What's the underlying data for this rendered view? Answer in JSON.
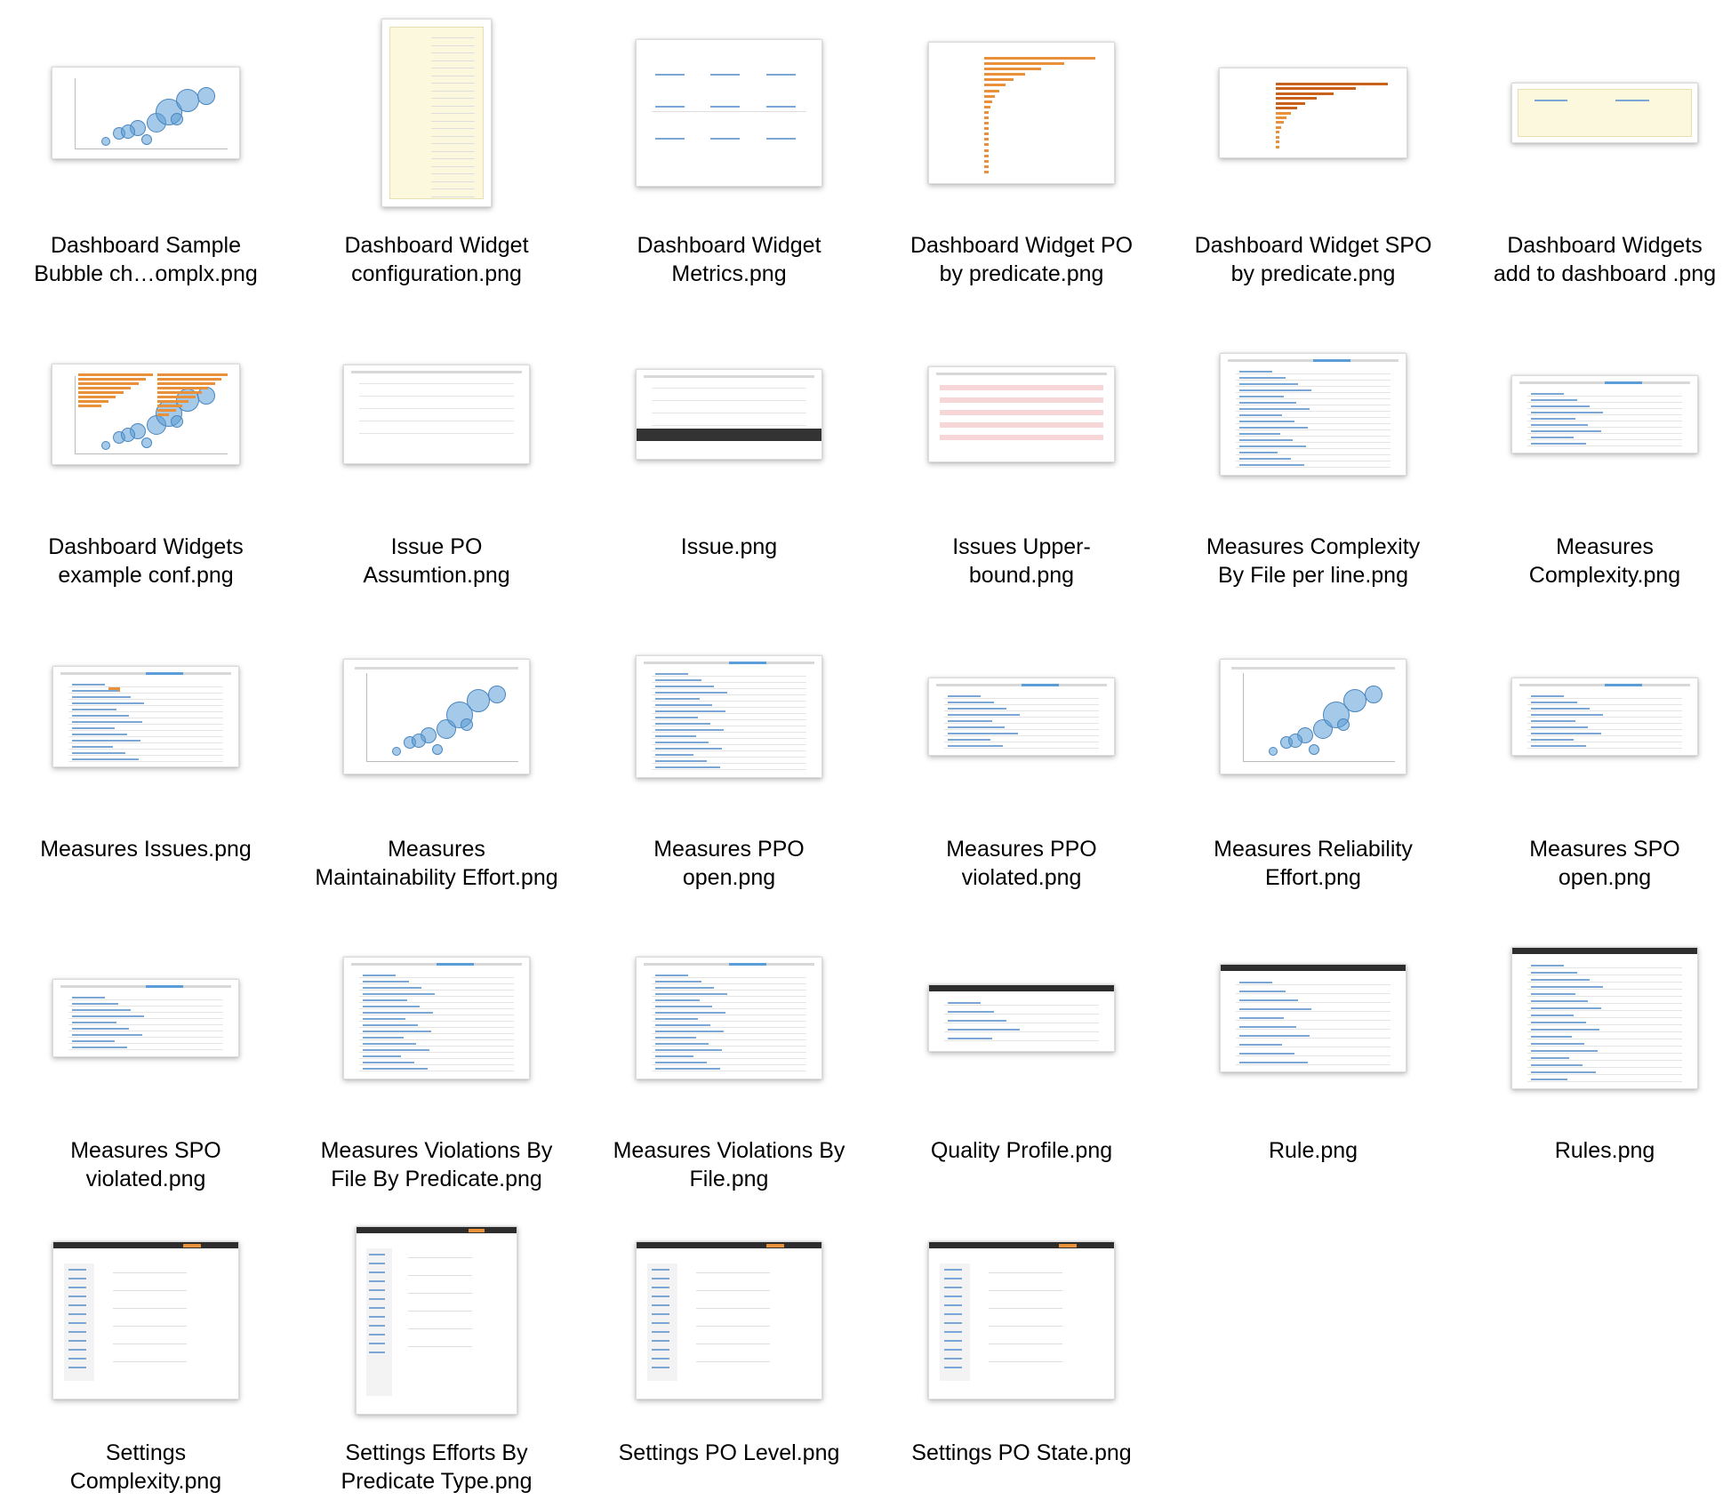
{
  "window": {
    "view": "icon-grid"
  },
  "files": [
    {
      "line1": "Dashboard Sample",
      "line2": "Bubble ch…omplx.png",
      "kind": "bubble"
    },
    {
      "line1": "Dashboard Widget",
      "line2": "configuration.png",
      "kind": "config"
    },
    {
      "line1": "Dashboard Widget",
      "line2": "Metrics.png",
      "kind": "metrics"
    },
    {
      "line1": "Dashboard Widget PO",
      "line2": "by predicate.png",
      "kind": "hbar"
    },
    {
      "line1": "Dashboard Widget SPO",
      "line2": "by predicate.png",
      "kind": "hbar-dark"
    },
    {
      "line1": "Dashboard Widgets",
      "line2": "add to dashboard .png",
      "kind": "addwidget"
    },
    {
      "line1": "Dashboard Widgets",
      "line2": "example conf.png",
      "kind": "combo"
    },
    {
      "line1": "Issue PO",
      "line2": "Assumtion.png",
      "kind": "issue"
    },
    {
      "line1": "Issue.png",
      "line2": "",
      "kind": "issue-dark"
    },
    {
      "line1": "Issues Upper-",
      "line2": "bound.png",
      "kind": "issue-red"
    },
    {
      "line1": "Measures Complexity",
      "line2": "By File per line.png",
      "kind": "list-tall"
    },
    {
      "line1": "Measures",
      "line2": "Complexity.png",
      "kind": "list"
    },
    {
      "line1": "Measures Issues.png",
      "line2": "",
      "kind": "list-badge"
    },
    {
      "line1": "Measures",
      "line2": "Maintainability Effort.png",
      "kind": "bubble-page"
    },
    {
      "line1": "Measures PPO",
      "line2": "open.png",
      "kind": "list-tall"
    },
    {
      "line1": "Measures PPO",
      "line2": "violated.png",
      "kind": "list"
    },
    {
      "line1": "Measures Reliability",
      "line2": "Effort.png",
      "kind": "bubble-page"
    },
    {
      "line1": "Measures SPO",
      "line2": "open.png",
      "kind": "list"
    },
    {
      "line1": "Measures SPO",
      "line2": "violated.png",
      "kind": "list"
    },
    {
      "line1": "Measures Violations By",
      "line2": "File By Predicate.png",
      "kind": "list-tall"
    },
    {
      "line1": "Measures Violations By",
      "line2": "File.png",
      "kind": "list-tall"
    },
    {
      "line1": "Quality Profile.png",
      "line2": "",
      "kind": "profile"
    },
    {
      "line1": "Rule.png",
      "line2": "",
      "kind": "rule"
    },
    {
      "line1": "Rules.png",
      "line2": "",
      "kind": "rules"
    },
    {
      "line1": "Settings",
      "line2": "Complexity.png",
      "kind": "settings"
    },
    {
      "line1": "Settings Efforts By",
      "line2": "Predicate Type.png",
      "kind": "settings-tall"
    },
    {
      "line1": "Settings PO Level.png",
      "line2": "",
      "kind": "settings"
    },
    {
      "line1": "Settings PO State.png",
      "line2": "",
      "kind": "settings"
    }
  ],
  "colors": {
    "label": "#000000",
    "thumb_border": "#dcdcdc",
    "accent_orange": "#e9913a",
    "accent_blue": "#5b9dd6"
  }
}
